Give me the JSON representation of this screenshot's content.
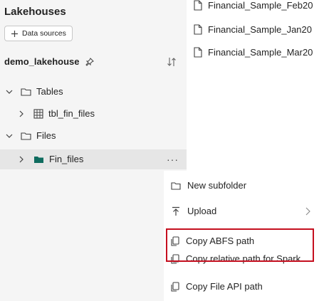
{
  "explorer": {
    "title": "Lakehouses",
    "data_sources_label": "Data sources",
    "lakehouse_name": "demo_lakehouse",
    "tables_label": "Tables",
    "table_item": "tbl_fin_files",
    "files_label": "Files",
    "folder_item": "Fin_files",
    "more_label": "···"
  },
  "file_list": [
    {
      "name": "Financial_Sample_Feb20"
    },
    {
      "name": "Financial_Sample_Jan20"
    },
    {
      "name": "Financial_Sample_Mar20"
    }
  ],
  "context_menu": {
    "new_subfolder": "New subfolder",
    "upload": "Upload",
    "copy_abfs": "Copy ABFS path",
    "copy_relative": "Copy relative path for Spark",
    "copy_file_api": "Copy File API path"
  },
  "colors": {
    "highlight_border": "#c50f1f",
    "selected_row": "#e6e6e6",
    "folder_icon": "#0f6c5f"
  }
}
